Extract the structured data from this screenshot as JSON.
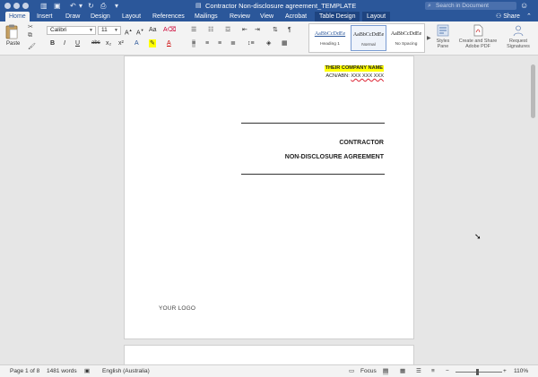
{
  "window": {
    "title": "Contractor Non-disclosure agreement_TEMPLATE",
    "search_placeholder": "Search in Document"
  },
  "tabs": [
    {
      "label": "Home",
      "active": true
    },
    {
      "label": "Insert"
    },
    {
      "label": "Draw"
    },
    {
      "label": "Design"
    },
    {
      "label": "Layout"
    },
    {
      "label": "References"
    },
    {
      "label": "Mailings"
    },
    {
      "label": "Review"
    },
    {
      "label": "View"
    },
    {
      "label": "Acrobat"
    },
    {
      "label": "Table Design",
      "contextual": true
    },
    {
      "label": "Layout",
      "contextual": true
    }
  ],
  "share_label": "Share",
  "ribbon": {
    "paste_label": "Paste",
    "font_name": "Calibri",
    "font_size": "11",
    "font_buttons": [
      "B",
      "I",
      "U",
      "abc",
      "x₂",
      "x²"
    ],
    "styles": [
      {
        "sample": "AaBbCcDdEe",
        "name": "Heading 1"
      },
      {
        "sample": "AaBbCcDdEe",
        "name": "Normal",
        "selected": true
      },
      {
        "sample": "AaBbCcDdEe",
        "name": "No Spacing"
      }
    ],
    "styles_pane_label": "Styles Pane",
    "create_pdf_label": "Create and Share Adobe PDF",
    "request_signatures_label": "Request Signatures"
  },
  "document": {
    "company_name": "THEIR COMPANY NAME",
    "acn_prefix": "ACN/ABN: ",
    "acn_value": "XXX XXX XXX",
    "heading_1": "CONTRACTOR",
    "heading_2": "NON-DISCLOSURE AGREEMENT",
    "logo_placeholder": "YOUR LOGO"
  },
  "status": {
    "page": "Page 1 of 8",
    "words": "1481 words",
    "language": "English (Australia)",
    "focus": "Focus",
    "zoom": "110%"
  },
  "colors": {
    "accent": "#2b579a",
    "highlight": "#ffff00"
  }
}
